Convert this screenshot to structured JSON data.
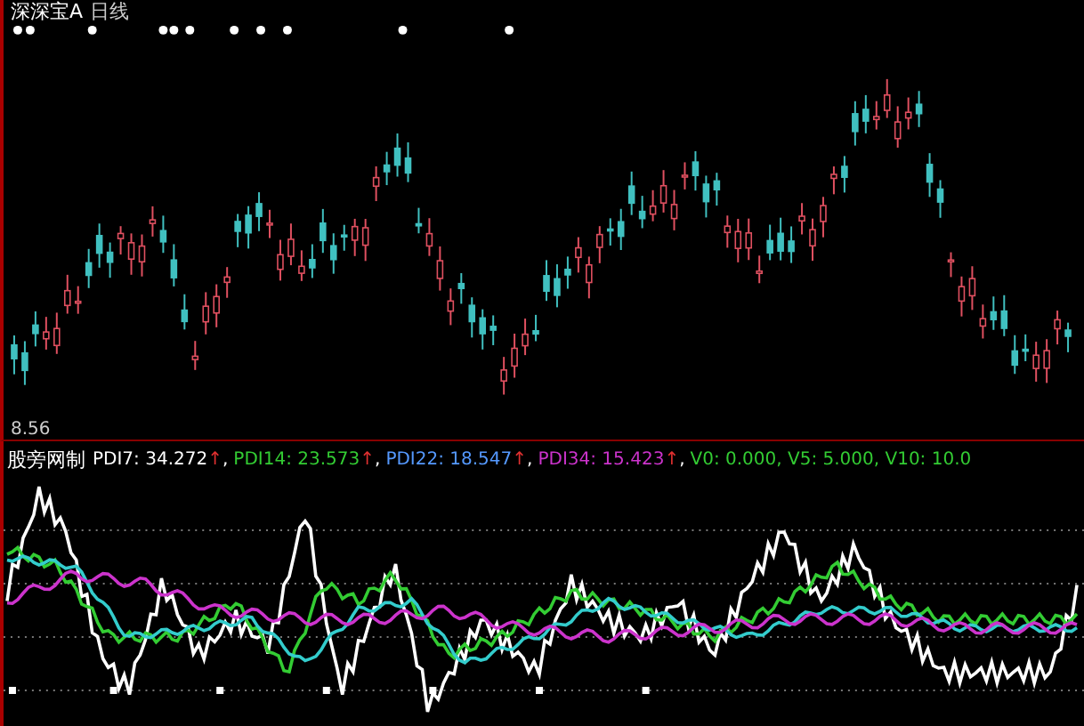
{
  "chart_header": {
    "stock_name": "深深宝A",
    "period": "日线"
  },
  "price_panel": {
    "low_price_label": "8.56"
  },
  "indicator_panel": {
    "name": "股旁网制",
    "readings": [
      {
        "label": "PDI7: 34.272",
        "arrow": "↑",
        "separator": ",",
        "color": "#ffffff"
      },
      {
        "label": "PDI14: 23.573",
        "arrow": "↑",
        "separator": ",",
        "color": "#33cc33"
      },
      {
        "label": "PDI22: 18.547",
        "arrow": "↑",
        "separator": ",",
        "color": "#5599ff"
      },
      {
        "label": "PDI34: 15.423",
        "arrow": "↑",
        "separator": ",",
        "color": "#cc33cc"
      },
      {
        "label": "V0: 0.000, V5: 5.000, V10: 10.0",
        "color": "#33cc33"
      }
    ]
  }
}
